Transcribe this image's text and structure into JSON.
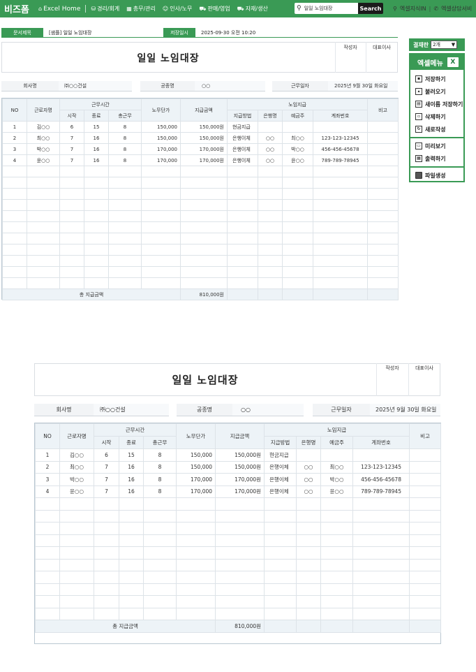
{
  "nav": {
    "brand": "비즈폼",
    "items": [
      "Excel Home",
      "경리/회계",
      "총무/관리",
      "인사/노무",
      "판매/영업",
      "자재/생산"
    ],
    "search_value": "일일 노임대장",
    "search_button": "Search",
    "right_items": [
      "엑셀지식IN",
      "엑셀상담서비"
    ]
  },
  "doc_header": {
    "title_label": "문서제목",
    "title_value": "[샘플] 일일 노임대장",
    "saved_label": "저장일시",
    "saved_value": "2025-09-30  오전 10:20"
  },
  "sheet": {
    "title": "일일 노임대장",
    "sign": [
      "작성자",
      "대표이사"
    ],
    "company_label": "회사명",
    "company_value": "㈜○○건설",
    "type_label": "공종명",
    "type_value": "○○",
    "date_label": "근무일자",
    "date_value": "2025년 9월 30일 화요일",
    "headers": {
      "no": "NO",
      "worker": "근로자명",
      "work_time": "근무시간",
      "start": "시작",
      "end": "종료",
      "total": "총근무",
      "unit_price": "노무단가",
      "amount": "지급금액",
      "pay": "노임지급",
      "method": "지급방법",
      "bank": "은행명",
      "holder": "예금주",
      "account": "계좌번호",
      "note": "비고"
    },
    "rows": [
      [
        "1",
        "김○○",
        "6",
        "15",
        "8",
        "150,000",
        "150,000원",
        "현금지급",
        "",
        "",
        "",
        ""
      ],
      [
        "2",
        "최○○",
        "7",
        "16",
        "8",
        "150,000",
        "150,000원",
        "은행이체",
        "○○",
        "최○○",
        "123-123-12345",
        ""
      ],
      [
        "3",
        "박○○",
        "7",
        "16",
        "8",
        "170,000",
        "170,000원",
        "은행이체",
        "○○",
        "박○○",
        "456-456-45678",
        ""
      ],
      [
        "4",
        "윤○○",
        "7",
        "16",
        "8",
        "170,000",
        "170,000원",
        "은행이체",
        "○○",
        "윤○○",
        "789-789-78945",
        ""
      ]
    ],
    "total_label": "총 지급금액",
    "total_value": "810,000원"
  },
  "panel": {
    "approval_label": "결재란",
    "approval_value": "2개",
    "menu_title": "엑셀메뉴",
    "menu_group1": [
      "저장하기",
      "불러오기",
      "새이름 저장하기",
      "삭제하기",
      "새로작성"
    ],
    "menu_group2": [
      "미리보기",
      "출력하기"
    ],
    "menu_group3": [
      "파일생성"
    ]
  }
}
